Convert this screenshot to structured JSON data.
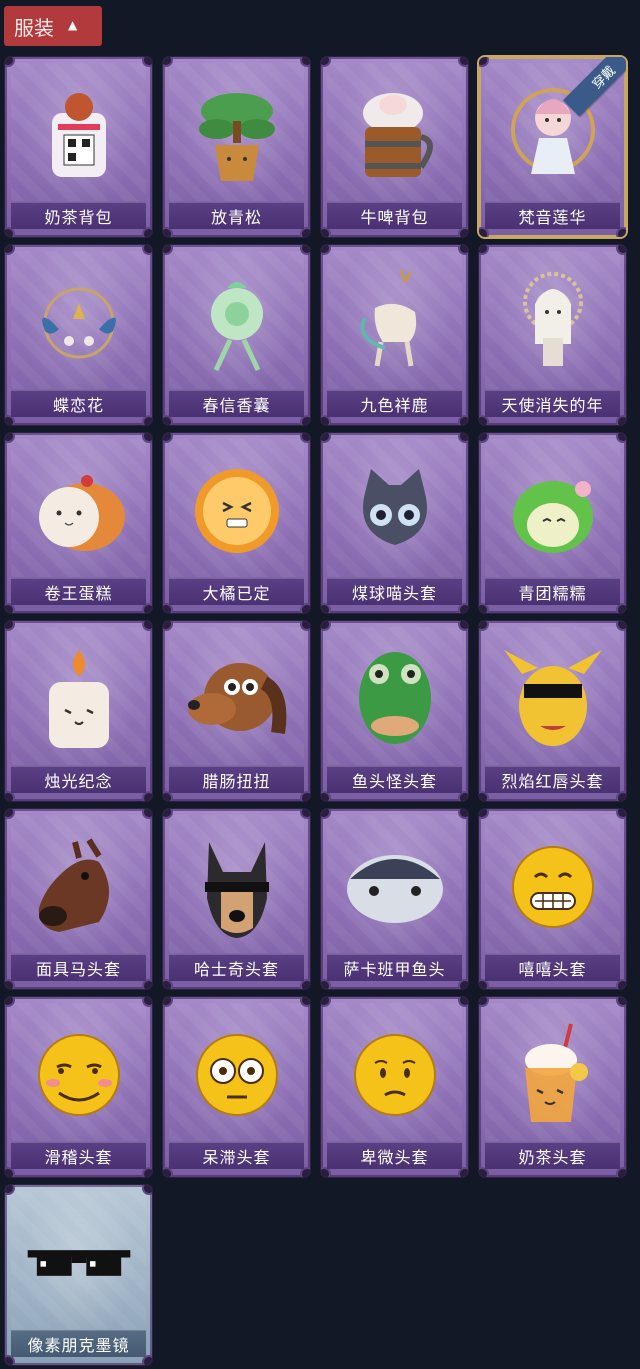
{
  "header": {
    "tab_label": "服装",
    "chevron_icon": "chevron-up-icon"
  },
  "equipped_badge": "穿戴",
  "items": [
    {
      "label": "奶茶背包",
      "icon": "milk-tea-backpack-icon"
    },
    {
      "label": "放青松",
      "icon": "bonsai-pine-icon"
    },
    {
      "label": "牛啤背包",
      "icon": "beer-mug-backpack-icon"
    },
    {
      "label": "梵音莲华",
      "icon": "lotus-character-icon",
      "equipped": true
    },
    {
      "label": "蝶恋花",
      "icon": "butterfly-flower-icon"
    },
    {
      "label": "春信香囊",
      "icon": "sachet-icon"
    },
    {
      "label": "九色祥鹿",
      "icon": "deer-icon"
    },
    {
      "label": "天使消失的年",
      "icon": "angel-doll-icon"
    },
    {
      "label": "卷王蛋糕",
      "icon": "roll-cake-icon"
    },
    {
      "label": "大橘已定",
      "icon": "orange-slice-icon"
    },
    {
      "label": "煤球喵头套",
      "icon": "black-cat-mask-icon"
    },
    {
      "label": "青团糯糯",
      "icon": "green-dumpling-icon"
    },
    {
      "label": "烛光纪念",
      "icon": "candle-icon"
    },
    {
      "label": "腊肠扭扭",
      "icon": "dachshund-mask-icon"
    },
    {
      "label": "鱼头怪头套",
      "icon": "fish-head-mask-icon"
    },
    {
      "label": "烈焰红唇头套",
      "icon": "yellow-mask-icon"
    },
    {
      "label": "面具马头套",
      "icon": "horse-mask-icon"
    },
    {
      "label": "哈士奇头套",
      "icon": "husky-mask-icon"
    },
    {
      "label": "萨卡班甲鱼头",
      "icon": "fish-mask-icon"
    },
    {
      "label": "嘻嘻头套",
      "icon": "grin-emoji-icon"
    },
    {
      "label": "滑稽头套",
      "icon": "funny-emoji-icon"
    },
    {
      "label": "呆滞头套",
      "icon": "dazed-emoji-icon"
    },
    {
      "label": "卑微头套",
      "icon": "humble-emoji-icon"
    },
    {
      "label": "奶茶头套",
      "icon": "milk-tea-cup-icon"
    },
    {
      "label": "像素朋克墨镜",
      "icon": "pixel-sunglasses-icon",
      "rarity": "blue"
    }
  ]
}
